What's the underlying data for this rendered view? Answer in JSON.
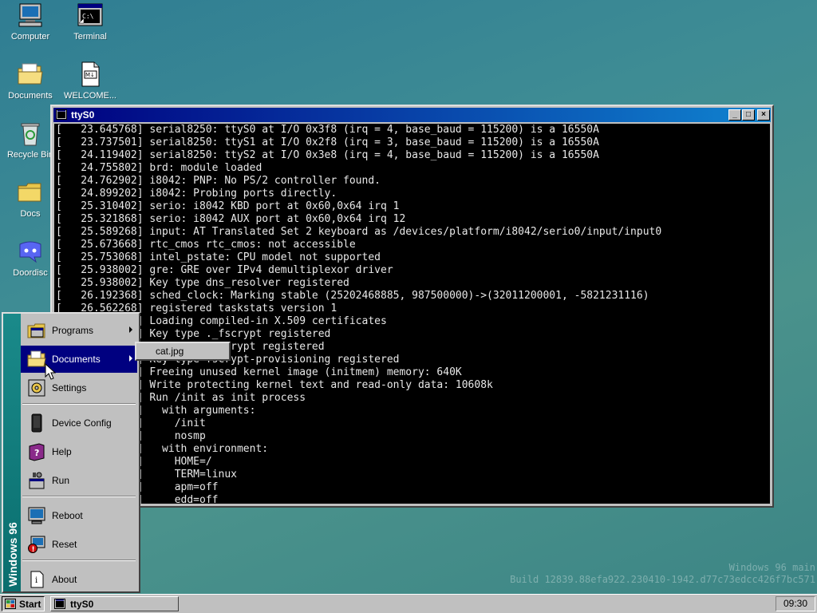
{
  "desktop": {
    "icons": [
      {
        "label": "Computer",
        "icon": "computer-icon"
      },
      {
        "label": "Terminal",
        "icon": "terminal-icon"
      },
      {
        "label": "Documents",
        "icon": "documents-folder-icon"
      },
      {
        "label": "WELCOME...",
        "icon": "markdown-file-icon"
      },
      {
        "label": "Recycle Bin",
        "icon": "recycle-bin-icon"
      },
      {
        "label": "Docs",
        "icon": "folder-icon"
      },
      {
        "label": "Doordisc",
        "icon": "discord-icon"
      }
    ],
    "watermark_line1": "Windows 96 main",
    "watermark_line2": "Build 12839.88efa922.230410-1942.d77c73edcc426f7bc571"
  },
  "window": {
    "title": "ttyS0",
    "minimize": "_",
    "maximize": "□",
    "close": "×",
    "lines": [
      "[   23.645768] serial8250: ttyS0 at I/O 0x3f8 (irq = 4, base_baud = 115200) is a 16550A",
      "[   23.737501] serial8250: ttyS1 at I/O 0x2f8 (irq = 3, base_baud = 115200) is a 16550A",
      "[   24.119402] serial8250: ttyS2 at I/O 0x3e8 (irq = 4, base_baud = 115200) is a 16550A",
      "[   24.755802] brd: module loaded",
      "[   24.762902] i8042: PNP: No PS/2 controller found.",
      "[   24.899202] i8042: Probing ports directly.",
      "[   25.310402] serio: i8042 KBD port at 0x60,0x64 irq 1",
      "[   25.321868] serio: i8042 AUX port at 0x60,0x64 irq 12",
      "[   25.589268] input: AT Translated Set 2 keyboard as /devices/platform/i8042/serio0/input/input0",
      "[   25.673668] rtc_cmos rtc_cmos: not accessible",
      "[   25.753068] intel_pstate: CPU model not supported",
      "[   25.938002] gre: GRE over IPv4 demultiplexor driver",
      "[   25.938002] Key type dns_resolver registered",
      "[   26.192368] sched_clock: Marking stable (25202468885, 987500000)->(32011200001, -5821231116)",
      "[   26.562268] registered taskstats version 1",
      "[   26.611468] Loading compiled-in X.509 certificates",
      "[   26.829802] Key type ._fscrypt registered",
      "[   26.830068] Key type .fscrypt registered",
      "[   26.830402] Key type fscrypt-provisioning registered",
      "[   27.050668] Freeing unused kernel image (initmem) memory: 640K",
      "[   27.100335] Write protecting kernel text and read-only data: 10608k",
      "[   27.100468] Run /init as init process",
      "[   27.100535]   with arguments:",
      "[   27.100568]     /init",
      "[   27.100602]     nosmp",
      "[   27.100635]   with environment:",
      "[   27.100668]     HOME=/",
      "[   27.100702]     TERM=linux",
      "[   27.100735]     apm=off",
      "[   27.100768]     edd=off"
    ]
  },
  "start_menu": {
    "banner": "Windows 96",
    "items": [
      {
        "label": "Programs",
        "icon": "programs-icon",
        "submenu": true
      },
      {
        "label": "Documents",
        "icon": "documents-icon",
        "submenu": true
      },
      {
        "label": "Settings",
        "icon": "settings-icon",
        "submenu": false
      },
      {
        "label": "Device Config",
        "icon": "device-config-icon",
        "submenu": false
      },
      {
        "label": "Help",
        "icon": "help-book-icon",
        "submenu": false
      },
      {
        "label": "Run",
        "icon": "run-icon",
        "submenu": false
      },
      {
        "label": "Reboot",
        "icon": "reboot-icon",
        "submenu": false
      },
      {
        "label": "Reset",
        "icon": "reset-icon",
        "submenu": false
      },
      {
        "label": "About",
        "icon": "about-icon",
        "submenu": false
      }
    ],
    "documents_submenu": [
      "cat.jpg"
    ]
  },
  "taskbar": {
    "start_label": "Start",
    "task_label": "ttyS0",
    "clock": "09:30"
  },
  "colors": {
    "desktop": "#3e8c94",
    "titlebar": "#000080",
    "highlight": "#000080",
    "terminal_bg": "#000000"
  }
}
